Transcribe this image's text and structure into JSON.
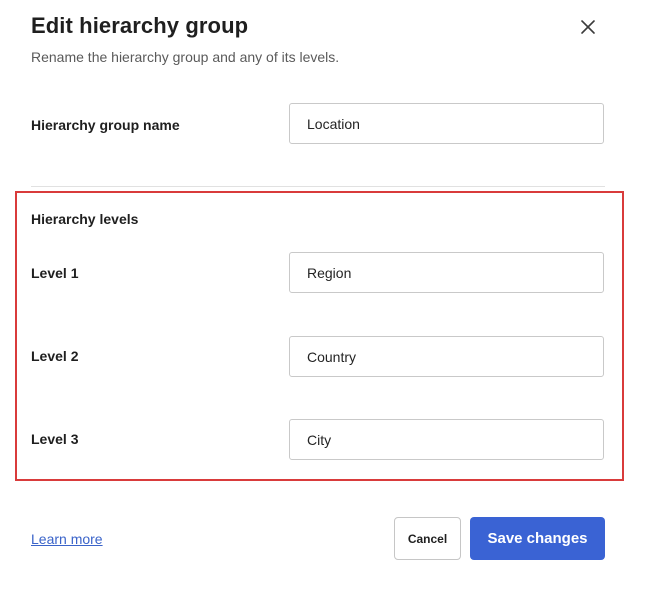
{
  "dialog": {
    "title": "Edit hierarchy group",
    "subtitle": "Rename the hierarchy group and any of its levels.",
    "close_icon": "close-icon"
  },
  "group_name": {
    "label": "Hierarchy group name",
    "value": "Location"
  },
  "levels": {
    "heading": "Hierarchy levels",
    "items": [
      {
        "label": "Level 1",
        "value": "Region"
      },
      {
        "label": "Level 2",
        "value": "Country"
      },
      {
        "label": "Level 3",
        "value": "City"
      }
    ]
  },
  "footer": {
    "learn_more": "Learn more",
    "cancel_label": "Cancel",
    "save_label": "Save changes"
  },
  "colors": {
    "primary": "#3a63d4",
    "link": "#3a63c9",
    "highlight_border": "#d93b3b"
  }
}
